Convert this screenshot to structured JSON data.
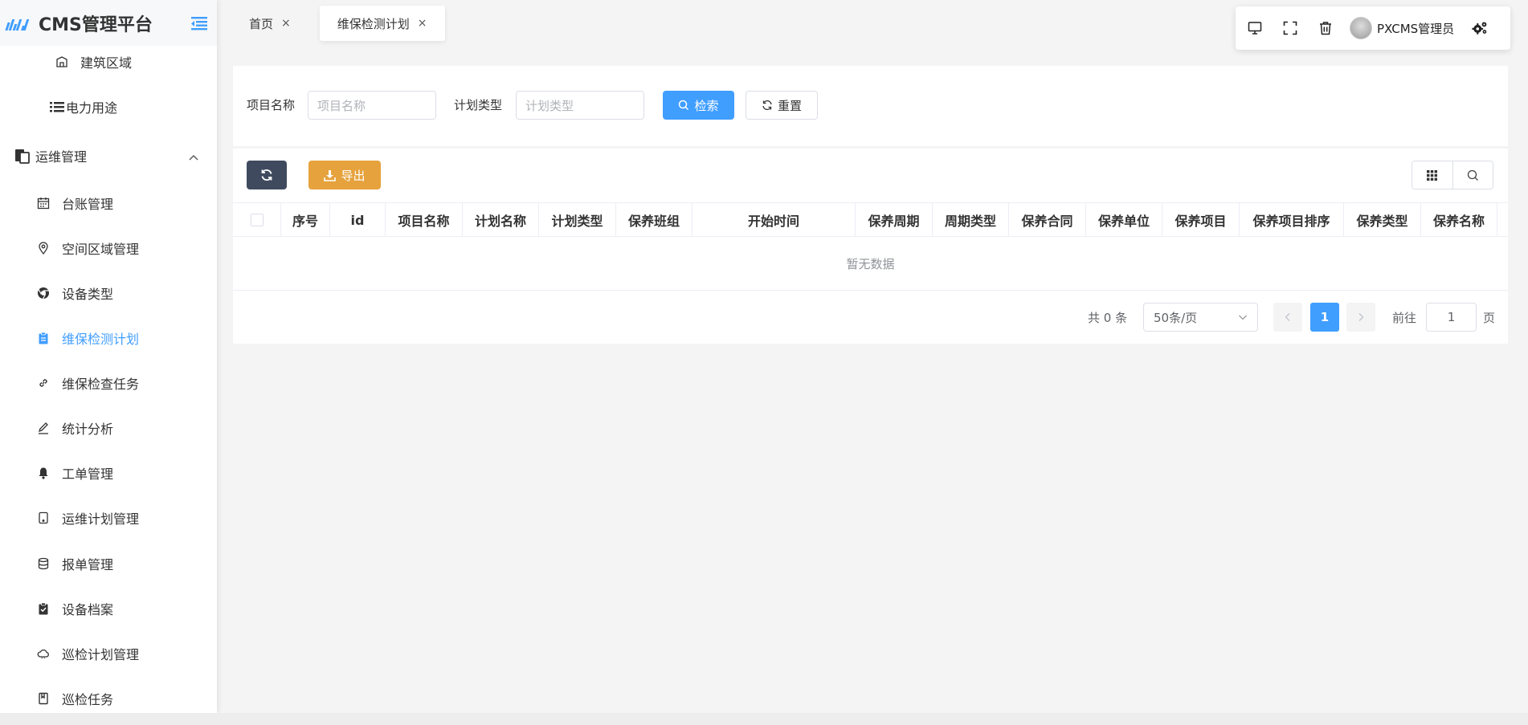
{
  "app": {
    "title": "CMS管理平台"
  },
  "sidebar": {
    "items": [
      {
        "label": "建筑区域",
        "icon": "building-icon"
      },
      {
        "label": "电力用途",
        "icon": "list-icon"
      }
    ],
    "group": {
      "label": "运维管理",
      "icon": "clipboard-copy-icon",
      "expanded": true
    },
    "sub_items": [
      {
        "label": "台账管理",
        "icon": "calendar-icon"
      },
      {
        "label": "空间区域管理",
        "icon": "location-pin-icon"
      },
      {
        "label": "设备类型",
        "icon": "chrome-icon"
      },
      {
        "label": "维保检测计划",
        "icon": "clipboard-icon",
        "active": true
      },
      {
        "label": "维保检查任务",
        "icon": "link-icon"
      },
      {
        "label": "统计分析",
        "icon": "edit-icon"
      },
      {
        "label": "工单管理",
        "icon": "bell-icon"
      },
      {
        "label": "运维计划管理",
        "icon": "tablet-icon"
      },
      {
        "label": "报单管理",
        "icon": "database-icon"
      },
      {
        "label": "设备档案",
        "icon": "clipboard-check-icon"
      },
      {
        "label": "巡检计划管理",
        "icon": "cloud-icon"
      },
      {
        "label": "巡检任务",
        "icon": "book-icon"
      }
    ]
  },
  "tabs": [
    {
      "label": "首页",
      "close": "×"
    },
    {
      "label": "维保检测计划",
      "close": "×",
      "active": true
    }
  ],
  "topbar": {
    "user": "PXCMS管理员"
  },
  "search": {
    "project_name_label": "项目名称",
    "project_name_placeholder": "项目名称",
    "plan_type_label": "计划类型",
    "plan_type_placeholder": "计划类型",
    "search_button": "检索",
    "reset_button": "重置"
  },
  "toolbar": {
    "export_button": "导出"
  },
  "table": {
    "columns": [
      "序号",
      "id",
      "项目名称",
      "计划名称",
      "计划类型",
      "保养班组",
      "开始时间",
      "保养周期",
      "周期类型",
      "保养合同",
      "保养单位",
      "保养项目",
      "保养项目排序",
      "保养类型",
      "保养名称"
    ],
    "empty_text": "暂无数据"
  },
  "pagination": {
    "total_text": "共 0 条",
    "page_size": "50条/页",
    "current_page": "1",
    "goto_label": "前往",
    "goto_value": "1",
    "page_unit": "页"
  },
  "colors": {
    "accent": "#409eff",
    "warning": "#e6a23c",
    "dark": "#3f4a5e"
  }
}
